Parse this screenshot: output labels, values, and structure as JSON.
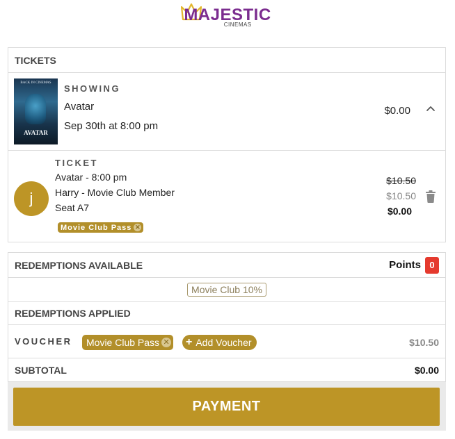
{
  "brand": {
    "logo_text": "MAJESTIC",
    "logo_sub": "CINEMAS"
  },
  "tickets_section": {
    "header": "TICKETS",
    "showing": {
      "label": "SHOWING",
      "title": "Avatar",
      "datetime": "Sep 30th at 8:00 pm",
      "price": "$0.00",
      "poster_top_text": "BACK IN CINEMAS",
      "poster_title": "AVATAR"
    },
    "ticket": {
      "label": "TICKET",
      "initial": "j",
      "line1": "Avatar - 8:00 pm",
      "line2": "Harry - Movie Club Member",
      "line3": "Seat A7",
      "tag": "Movie Club Pass",
      "price_original": "$10.50",
      "price_discounted": "$10.50",
      "price_final": "$0.00"
    }
  },
  "redemptions": {
    "available_header": "REDEMPTIONS AVAILABLE",
    "points_label": "Points",
    "points_value": "0",
    "available_option": "Movie Club 10%",
    "applied_header": "REDEMPTIONS APPLIED",
    "voucher_label": "VOUCHER",
    "voucher_chip": "Movie Club Pass",
    "add_voucher": "Add Voucher",
    "voucher_amount": "$10.50",
    "subtotal_label": "SUBTOTAL",
    "subtotal_value": "$0.00"
  },
  "payment": {
    "button_label": "PAYMENT"
  },
  "colors": {
    "gold": "#bd9526",
    "brand_purple": "#7b2c8f",
    "points_badge": "#e53a2e"
  },
  "icons": {
    "collapse": "chevron-up-icon",
    "delete": "trash-icon",
    "remove": "close-circle-icon",
    "add": "plus-icon"
  }
}
